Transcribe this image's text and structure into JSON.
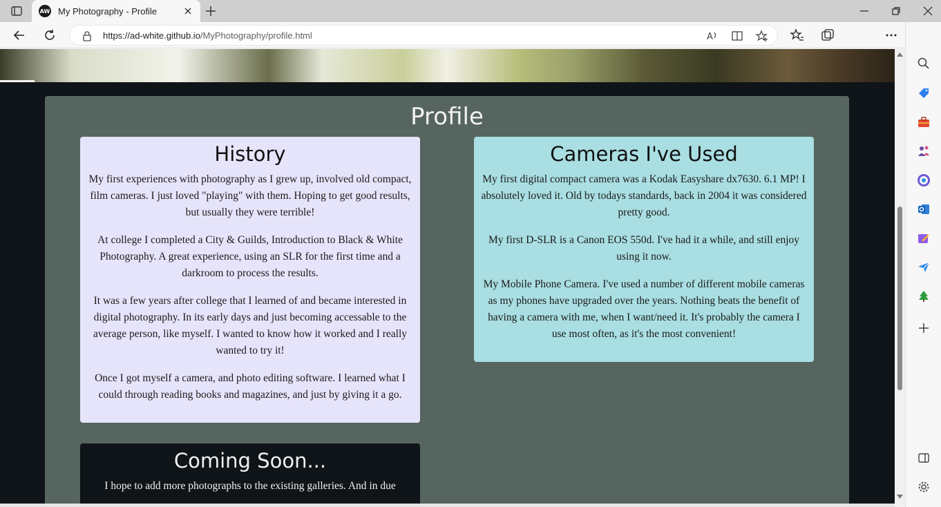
{
  "browser": {
    "tab_title": "My Photography - Profile",
    "tab_favicon_text": "AW",
    "url_host": "https://ad-white.github.io",
    "url_path": "/MyPhotography/profile.html"
  },
  "page": {
    "heading": "Profile",
    "history": {
      "title": "History",
      "paragraphs": [
        "My first experiences with photography as I grew up, involved old compact, film cameras. I just loved \"playing\" with them. Hoping to get good results, but usually they were terrible!",
        "At college I completed a City & Guilds, Introduction to Black & White Photography. A great experience, using an SLR for the first time and a darkroom to process the results.",
        "It was a few years after college that I learned of and became interested in digital photography. In its early days and just becoming accessable to the average person, like myself. I wanted to know how it worked and I really wanted to try it!",
        "Once I got myself a camera, and photo editing software. I learned what I could through reading books and magazines, and just by giving it a go."
      ]
    },
    "cameras": {
      "title": "Cameras I've Used",
      "paragraphs": [
        "My first digital compact camera was a Kodak Easyshare dx7630. 6.1 MP! I absolutely loved it. Old by todays standards, back in 2004 it was considered pretty good.",
        "My first D-SLR is a Canon EOS 550d. I've had it a while, and still enjoy using it now.",
        "My Mobile Phone Camera. I've used a number of different mobile cameras as my phones have upgraded over the years. Nothing beats the benefit of having a camera with me, when I want/need it. It's probably the camera I use most often, as it's the most convenient!"
      ]
    },
    "coming_soon": {
      "title": "Coming Soon...",
      "paragraphs": [
        "I hope to add more photographs to the existing galleries. And in due"
      ]
    }
  },
  "colors": {
    "panel_bg": "#56655f",
    "history_bg": "#e6e4fb",
    "cameras_bg": "#a9dee2",
    "page_bg": "#0f1418"
  }
}
